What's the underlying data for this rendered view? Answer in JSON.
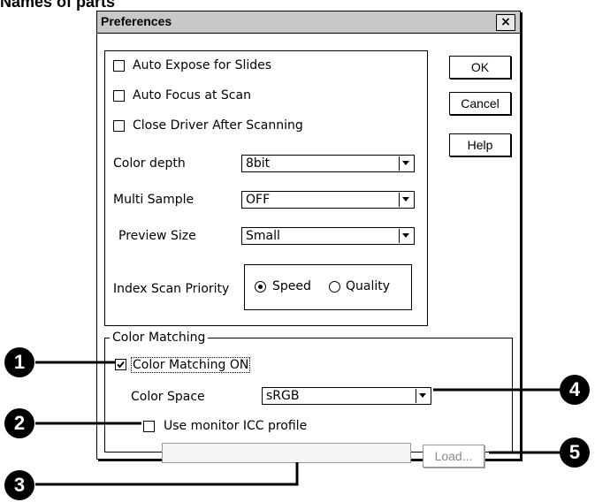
{
  "heading": "Names of parts",
  "dialog": {
    "title": "Preferences",
    "close_symbol": "×"
  },
  "buttons": {
    "ok": "OK",
    "cancel": "Cancel",
    "help": "Help",
    "load": "Load..."
  },
  "checkboxes": {
    "auto_expose": {
      "label": "Auto Expose for Slides",
      "checked": false
    },
    "auto_focus": {
      "label": "Auto Focus at Scan",
      "checked": false
    },
    "close_driver": {
      "label": "Close Driver After Scanning",
      "checked": false
    },
    "color_matching_on": {
      "label": "Color Matching ON",
      "checked": true
    },
    "use_monitor_icc": {
      "label": "Use monitor ICC profile",
      "checked": false
    }
  },
  "fields": {
    "color_depth": {
      "label": "Color depth",
      "value": "8bit"
    },
    "multi_sample": {
      "label": "Multi Sample",
      "value": "OFF"
    },
    "preview_size": {
      "label": "Preview Size",
      "value": "Small"
    },
    "color_space": {
      "label": "Color Space",
      "value": "sRGB"
    },
    "icc_profile_path": {
      "value": ""
    }
  },
  "index_scan": {
    "label": "Index Scan Priority",
    "options": [
      "Speed",
      "Quality"
    ],
    "selected": "Speed"
  },
  "color_matching_group": {
    "label": "Color Matching"
  },
  "callouts": [
    "1",
    "2",
    "3",
    "4",
    "5"
  ],
  "icons": {
    "checkbox_check": "check-icon",
    "dropdown": "chevron-down-icon"
  }
}
